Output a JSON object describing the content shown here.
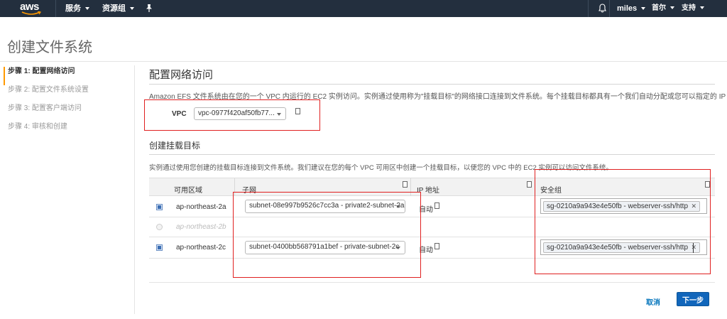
{
  "topnav": {
    "logo": "aws",
    "services": "服务",
    "resource_groups": "资源组",
    "user": "miles",
    "region": "首尔",
    "support": "支持"
  },
  "page": {
    "title": "创建文件系统"
  },
  "steps": [
    {
      "label": "步骤 1: 配置网络访问",
      "active": true
    },
    {
      "label": "步骤 2: 配置文件系统设置",
      "active": false
    },
    {
      "label": "步骤 3: 配置客户端访问",
      "active": false
    },
    {
      "label": "步骤 4: 审核和创建",
      "active": false
    }
  ],
  "network": {
    "heading": "配置网络访问",
    "description": "Amazon EFS 文件系统由在您的一个 VPC 内运行的 EC2 实例访问。实例通过使用称为\"挂载目标\"的网络接口连接到文件系统。每个挂载目标都具有一个我们自动分配或您可以指定的 IP 地址。",
    "vpc_label": "VPC",
    "vpc_value": "vpc-0977f420af50fb77..."
  },
  "mount_targets": {
    "heading": "创建挂载目标",
    "description": "实例通过使用您创建的挂载目标连接到文件系统。我们建议在您的每个 VPC 可用区中创建一个挂载目标，以便您的 VPC 中的 EC2 实例可以访问文件系统。",
    "columns": [
      "可用区域",
      "子网",
      "IP 地址",
      "安全组"
    ],
    "rows": [
      {
        "az": "ap-northeast-2a",
        "subnet": "subnet-08e997b9526c7cc3a - private2-subnet-2a",
        "ip": "自动",
        "sg": "sg-0210a9a943e4e50fb - webserver-ssh/http",
        "enabled": true
      },
      {
        "az": "ap-northeast-2b",
        "subnet": "",
        "ip": "",
        "sg": "",
        "enabled": false
      },
      {
        "az": "ap-northeast-2c",
        "subnet": "subnet-0400bb568791a1bef - private-subnet-2c",
        "ip": "自动",
        "sg": "sg-0210a9a943e4e50fb - webserver-ssh/http",
        "enabled": true
      }
    ]
  },
  "footer": {
    "cancel": "取消",
    "next": "下一步"
  },
  "colors": {
    "nav_bg": "#232f3e",
    "primary": "#1166bb",
    "link": "#0073bb",
    "highlight": "#e02020",
    "step_accent": "#ff9900"
  }
}
